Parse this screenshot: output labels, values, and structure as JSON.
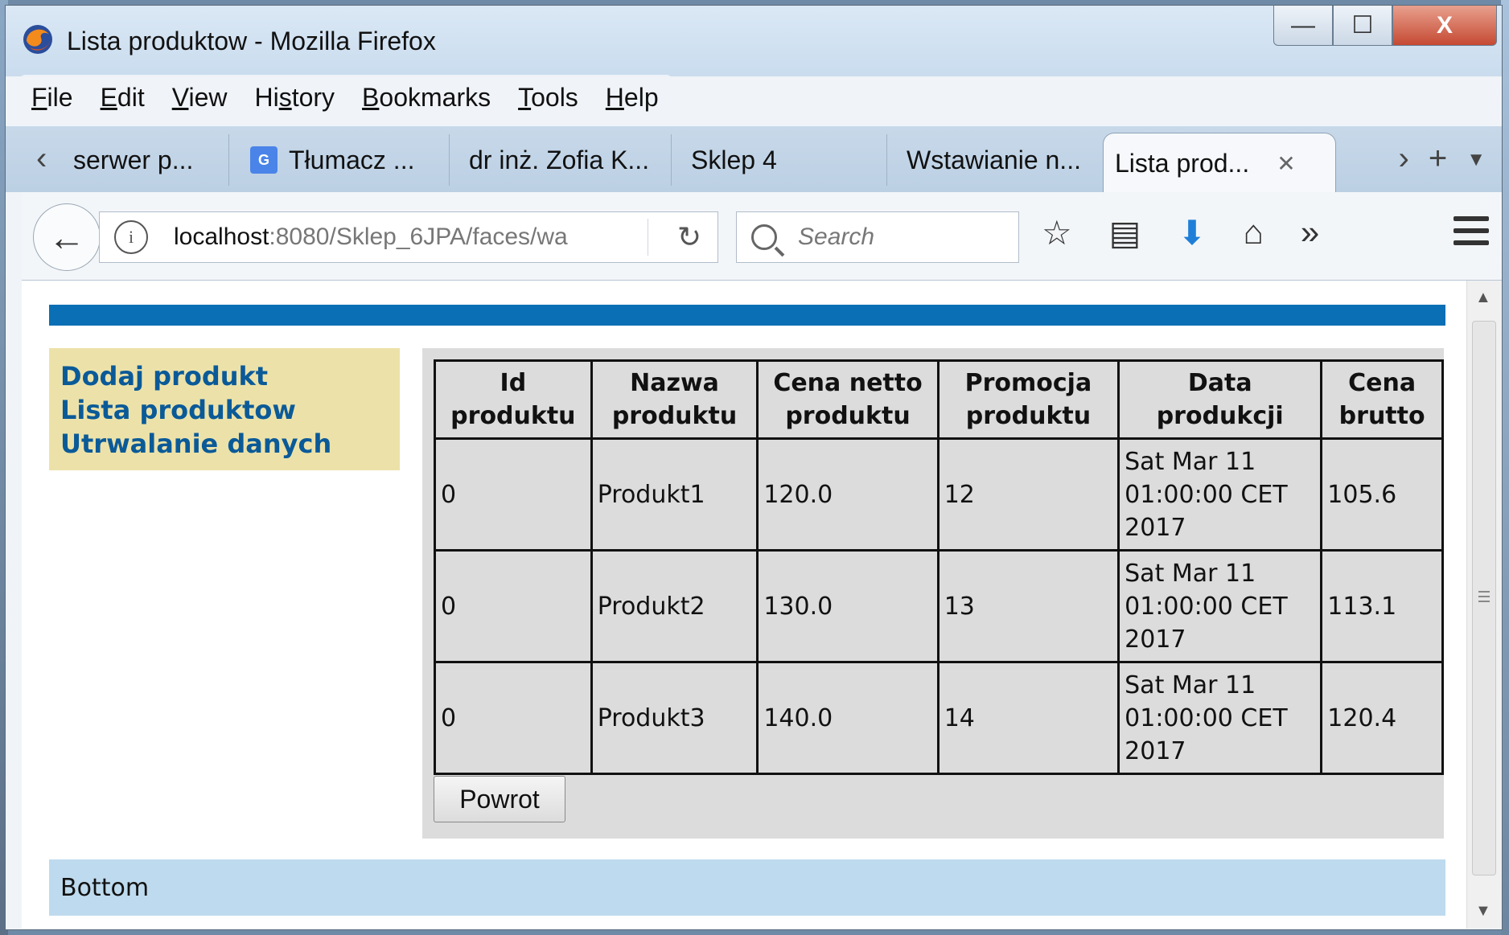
{
  "window": {
    "title": "Lista produktow - Mozilla Firefox",
    "buttons": {
      "minimize": "—",
      "maximize": "☐",
      "close": "X"
    }
  },
  "menu": [
    {
      "label": "File",
      "key": "F",
      "rest": "ile"
    },
    {
      "label": "Edit",
      "key": "E",
      "rest": "dit"
    },
    {
      "label": "View",
      "key": "V",
      "rest": "iew"
    },
    {
      "label": "History",
      "key": "s",
      "pre": "Hi",
      "rest": "tory"
    },
    {
      "label": "Bookmarks",
      "key": "B",
      "rest": "ookmarks"
    },
    {
      "label": "Tools",
      "key": "T",
      "rest": "ools"
    },
    {
      "label": "Help",
      "key": "H",
      "rest": "elp"
    }
  ],
  "tabs": [
    {
      "label": "serwer p..."
    },
    {
      "label": "Tłumacz ..."
    },
    {
      "label": "dr inż. Zofia K..."
    },
    {
      "label": "Sklep 4"
    },
    {
      "label": "Wstawianie n..."
    },
    {
      "label": "Lista prod...",
      "active": true
    }
  ],
  "nav": {
    "url_host": "localhost",
    "url_rest": ":8080/Sklep_6JPA/faces/wa",
    "search_placeholder": "Search"
  },
  "page": {
    "left_menu": [
      "Dodaj produkt",
      "Lista produktow",
      "Utrwalanie danych"
    ],
    "table": {
      "headers": [
        [
          "Id",
          "produktu"
        ],
        [
          "Nazwa",
          "produktu"
        ],
        [
          "Cena netto",
          "produktu"
        ],
        [
          "Promocja",
          "produktu"
        ],
        [
          "Data",
          "produkcji"
        ],
        [
          "Cena",
          "brutto"
        ]
      ],
      "rows": [
        [
          "0",
          "Produkt1",
          "120.0",
          "12",
          [
            "Sat Mar 11",
            "01:00:00 CET",
            "2017"
          ],
          "105.6"
        ],
        [
          "0",
          "Produkt2",
          "130.0",
          "13",
          [
            "Sat Mar 11",
            "01:00:00 CET",
            "2017"
          ],
          "113.1"
        ],
        [
          "0",
          "Produkt3",
          "140.0",
          "14",
          [
            "Sat Mar 11",
            "01:00:00 CET",
            "2017"
          ],
          "120.4"
        ]
      ]
    },
    "back_button": "Powrot",
    "footer": "Bottom"
  },
  "colors": {
    "top_bar": "#0a6fb5",
    "left_menu_bg": "#ece2a9",
    "left_menu_link": "#0b5a98",
    "content_bg": "#dcdcdc",
    "footer_bg": "#bedaee"
  }
}
